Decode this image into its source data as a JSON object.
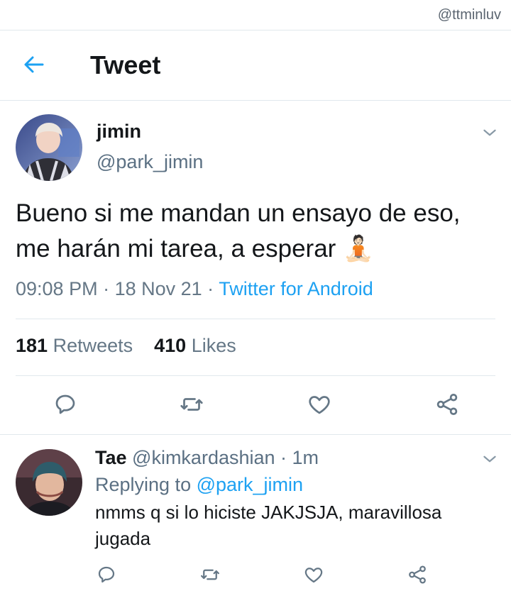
{
  "watermark": "@ttminluv",
  "header": {
    "title": "Tweet"
  },
  "tweet": {
    "name": "jimin",
    "handle": "@park_jimin",
    "text": "Bueno si me mandan un ensayo de eso, me harán mi tarea, a esperar 🧘🏻",
    "time": "09:08 PM",
    "sep1": " · ",
    "date": "18 Nov 21",
    "sep2": " · ",
    "source": "Twitter for Android",
    "retweets_count": "181",
    "retweets_label": " Retweets",
    "likes_count": "410",
    "likes_label": " Likes"
  },
  "reply": {
    "name": "Tae",
    "handle_time": " @kimkardashian · 1m",
    "replying_prefix": "Replying to ",
    "replying_to": "@park_jimin",
    "text": "nmms q si lo hiciste JAKJSJA, maravillosa jugada"
  },
  "icons": {
    "back": "arrow-left-icon",
    "reply": "comment-icon",
    "retweet": "retweet-icon",
    "like": "heart-icon",
    "share": "share-icon",
    "more": "chevron-down-icon"
  },
  "colors": {
    "accent": "#1da1f2",
    "secondary": "#657786",
    "divider": "#e1e8ed"
  }
}
